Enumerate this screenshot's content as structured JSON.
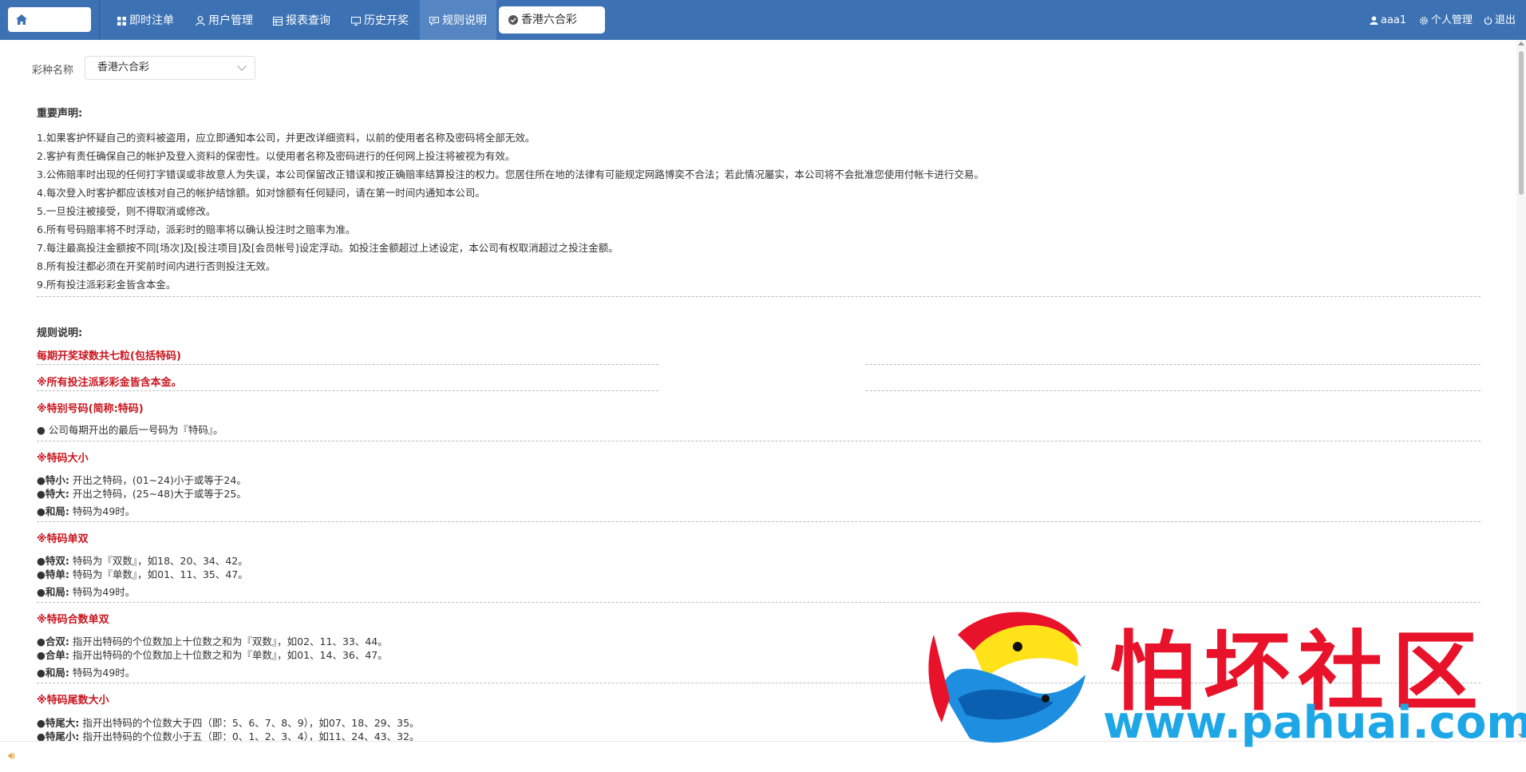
{
  "nav": {
    "items": [
      {
        "label": "即时注单",
        "icon": "grid-icon"
      },
      {
        "label": "用户管理",
        "icon": "user-icon"
      },
      {
        "label": "报表查询",
        "icon": "table-icon"
      },
      {
        "label": "历史开奖",
        "icon": "monitor-icon"
      },
      {
        "label": "规则说明",
        "icon": "message-icon"
      }
    ],
    "open_tab": "香港六合彩",
    "user": "aaa1",
    "profile": "个人管理",
    "logout": "退出"
  },
  "filter": {
    "label": "彩种名称",
    "value": "香港六合彩"
  },
  "disclaimer": {
    "title": "重要声明:",
    "lines": [
      "1.如果客护怀疑自己的资料被盗用，应立即通知本公司，并更改详细资料，以前的使用者名称及密码将全部无效。",
      "2.客护有责任确保自己的帐护及登入资料的保密性。以使用者名称及密码进行的任何网上投注将被视为有效。",
      "3.公佈赔率时出现的任何打字错误或非故意人为失误，本公司保留改正错误和按正确赔率结算投注的权力。您居住所在地的法律有可能规定网路博奕不合法；若此情况屬实，本公司将不会批准您使用付帐卡进行交易。",
      "4.每次登入时客护都应该核对自己的帐护结馀额。如对馀额有任何疑问，请在第一时间内通知本公司。",
      "5.一旦投注被接受，则不得取消或修改。",
      "6.所有号码赔率将不时浮动，派彩时的赔率将以确认投注时之赔率为准。",
      "7.每注最高投注金额按不同[场次]及[投注项目]及[会员帐号]设定浮动。如投注金额超过上述设定，本公司有权取消超过之投注金额。",
      "8.所有投注都必须在开奖前时间内进行否则投注无效。",
      "9.所有投注派彩彩金皆含本金。"
    ]
  },
  "rules": {
    "title": "规则说明:",
    "red1": "每期开奖球数共七粒(包括特码)",
    "red2": "※所有投注派彩彩金皆含本金。",
    "sections": [
      {
        "heading": "※特别号码(简称:特码)",
        "items": [
          {
            "key": "",
            "text": "● 公司每期开出的最后一号码为『特码』。"
          }
        ]
      },
      {
        "heading": "※特码大小",
        "items": [
          {
            "key": "●特小:",
            "text": "开出之特码，(01~24)小于或等于24。"
          },
          {
            "key": "●特大:",
            "text": "开出之特码，(25~48)大于或等于25。"
          },
          {
            "key": "●和局:",
            "text": "特码为49时。"
          }
        ]
      },
      {
        "heading": "※特码单双",
        "items": [
          {
            "key": "●特双:",
            "text": "特码为『双数』，如18、20、34、42。"
          },
          {
            "key": "●特单:",
            "text": "特码为『单数』，如01、11、35、47。"
          },
          {
            "key": "●和局:",
            "text": "特码为49时。"
          }
        ]
      },
      {
        "heading": "※特码合数单双",
        "items": [
          {
            "key": "●合双:",
            "text": "指开出特码的个位数加上十位数之和为『双数』，如02、11、33、44。"
          },
          {
            "key": "●合单:",
            "text": "指开出特码的个位数加上十位数之和为『单数』，如01、14、36、47。"
          },
          {
            "key": "●和局:",
            "text": "特码为49时。"
          }
        ]
      },
      {
        "heading": "※特码尾数大小",
        "items": [
          {
            "key": "●特尾大:",
            "text": "指开出特码的个位数大于四（即：5、6、7、8、9），如07、18、29、35。"
          },
          {
            "key": "●特尾小:",
            "text": "指开出特码的个位数小于五（即：0、1、2、3、4），如11、24、43、32。"
          }
        ]
      }
    ]
  },
  "watermark": {
    "title": "怕坏社区",
    "url": "www.pahuai.com"
  }
}
